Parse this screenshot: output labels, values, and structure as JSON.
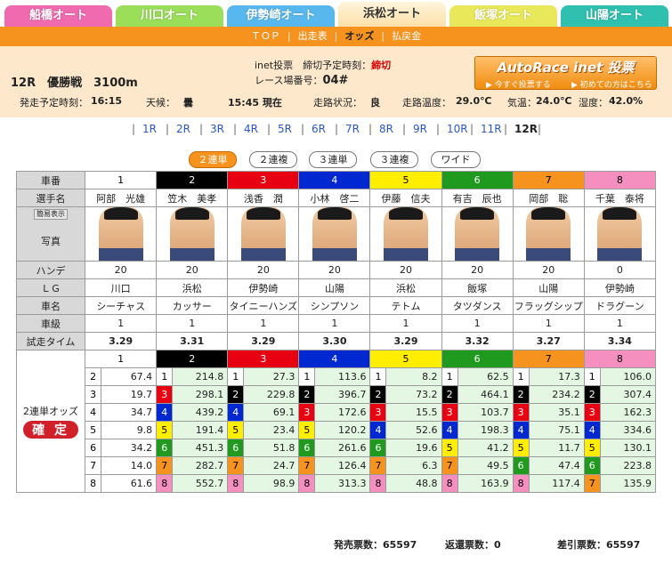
{
  "tabs": [
    {
      "label": "船橋オート",
      "color": "#f06ab0"
    },
    {
      "label": "川口オート",
      "color": "#9ade5a"
    },
    {
      "label": "伊勢崎オート",
      "color": "#58b8ee"
    },
    {
      "label": "浜松オート",
      "color": "#fde0a8",
      "active": true
    },
    {
      "label": "飯塚オート",
      "color": "#e8e85a"
    },
    {
      "label": "山陽オート",
      "color": "#30c0b0"
    }
  ],
  "subnav": [
    "ＴＯＰ",
    "出走表",
    "オッズ",
    "払戻金"
  ],
  "info": {
    "race": "12R　優勝戦　3100m",
    "inet_label": "inet投票　締切予定時刻：",
    "inet_value": "締切",
    "venue_label": "レース場番号：",
    "venue_value": "04#",
    "start_label": "発走予定時刻：",
    "start_value": "16:15",
    "weather_label": "天候：",
    "weather_value": "曇",
    "now_value": "15:45 現在",
    "track_label": "走路状況：",
    "track_value": "良",
    "track_temp_label": "走路温度：",
    "track_temp_value": "29.0℃",
    "air_label": "気温：",
    "air_value": "24.0℃",
    "humid_label": "湿度：",
    "humid_value": "42.0%"
  },
  "banner": {
    "title": "AutoRace inet 投票",
    "left": "▶ 今すぐ投票する",
    "right": "▶ 初めての方はこちら"
  },
  "race_links": [
    "1R",
    "2R",
    "3R",
    "4R",
    "5R",
    "6R",
    "7R",
    "8R",
    "9R",
    "10R",
    "11R",
    "12R"
  ],
  "bet_buttons": [
    "２連単",
    "２連複",
    "３連単",
    "３連複",
    "ワイド"
  ],
  "labels": {
    "num": "車番",
    "name": "選手名",
    "photo": "写真",
    "display": "簡易表示",
    "handicap": "ハンデ",
    "lg": "ＬＧ",
    "car": "車名",
    "rank": "車級",
    "trial": "試走タイム",
    "odds": "2連単オッズ",
    "kakutei": "確 定"
  },
  "racers": [
    {
      "num": "1",
      "name": "阿部　光雄",
      "hc": "20",
      "lg": "川口",
      "car": "シーチャス",
      "rank": "1",
      "trial": "3.29",
      "color": "#ffffff",
      "fg": "#000"
    },
    {
      "num": "2",
      "name": "笠木　美孝",
      "hc": "20",
      "lg": "浜松",
      "car": "カッサー",
      "rank": "1",
      "trial": "3.31",
      "color": "#000000",
      "fg": "#fff"
    },
    {
      "num": "3",
      "name": "浅香　潤",
      "hc": "20",
      "lg": "伊勢崎",
      "car": "タイニーハンズ",
      "rank": "1",
      "trial": "3.29",
      "color": "#e60012",
      "fg": "#fff"
    },
    {
      "num": "4",
      "name": "小林　啓二",
      "hc": "20",
      "lg": "山陽",
      "car": "シンプソン",
      "rank": "1",
      "trial": "3.30",
      "color": "#0028d0",
      "fg": "#fff"
    },
    {
      "num": "5",
      "name": "伊藤　信夫",
      "hc": "20",
      "lg": "浜松",
      "car": "テトム",
      "rank": "1",
      "trial": "3.29",
      "color": "#ffee00",
      "fg": "#000"
    },
    {
      "num": "6",
      "name": "有吉　辰也",
      "hc": "20",
      "lg": "飯塚",
      "car": "タツダンス",
      "rank": "1",
      "trial": "3.32",
      "color": "#1f9a1f",
      "fg": "#fff"
    },
    {
      "num": "7",
      "name": "岡部　聡",
      "hc": "20",
      "lg": "山陽",
      "car": "フラッグシップ",
      "rank": "1",
      "trial": "3.27",
      "color": "#f5931e",
      "fg": "#000"
    },
    {
      "num": "8",
      "name": "千葉　泰将",
      "hc": "0",
      "lg": "伊勢崎",
      "car": "ドラグーン",
      "rank": "1",
      "trial": "3.34",
      "color": "#f48fbf",
      "fg": "#000"
    }
  ],
  "odds": [
    [
      [
        "2",
        "67.4"
      ],
      [
        "1",
        "214.8"
      ],
      [
        "1",
        "27.3"
      ],
      [
        "1",
        "113.6"
      ],
      [
        "1",
        "8.2"
      ],
      [
        "1",
        "62.5"
      ],
      [
        "1",
        "17.3"
      ],
      [
        "1",
        "106.0"
      ]
    ],
    [
      [
        "3",
        "19.7"
      ],
      [
        "3",
        "298.1"
      ],
      [
        "2",
        "229.8"
      ],
      [
        "2",
        "396.7"
      ],
      [
        "2",
        "73.2"
      ],
      [
        "2",
        "464.1"
      ],
      [
        "2",
        "234.2"
      ],
      [
        "2",
        "307.4"
      ]
    ],
    [
      [
        "4",
        "34.7"
      ],
      [
        "4",
        "439.2"
      ],
      [
        "4",
        "69.1"
      ],
      [
        "3",
        "172.6"
      ],
      [
        "3",
        "15.5"
      ],
      [
        "3",
        "103.7"
      ],
      [
        "3",
        "35.1"
      ],
      [
        "3",
        "162.3"
      ]
    ],
    [
      [
        "5",
        "9.8"
      ],
      [
        "5",
        "191.4"
      ],
      [
        "5",
        "23.4"
      ],
      [
        "5",
        "120.2"
      ],
      [
        "4",
        "52.6"
      ],
      [
        "4",
        "198.3"
      ],
      [
        "4",
        "75.1"
      ],
      [
        "4",
        "334.6"
      ]
    ],
    [
      [
        "6",
        "34.2"
      ],
      [
        "6",
        "451.3"
      ],
      [
        "6",
        "51.8"
      ],
      [
        "6",
        "261.6"
      ],
      [
        "6",
        "19.6"
      ],
      [
        "5",
        "41.2"
      ],
      [
        "5",
        "11.7"
      ],
      [
        "5",
        "130.1"
      ]
    ],
    [
      [
        "7",
        "14.0"
      ],
      [
        "7",
        "282.7"
      ],
      [
        "7",
        "24.7"
      ],
      [
        "7",
        "126.4"
      ],
      [
        "7",
        "6.3"
      ],
      [
        "7",
        "49.5"
      ],
      [
        "6",
        "47.4"
      ],
      [
        "6",
        "223.8"
      ]
    ],
    [
      [
        "8",
        "61.6"
      ],
      [
        "8",
        "552.7"
      ],
      [
        "8",
        "98.9"
      ],
      [
        "8",
        "313.3"
      ],
      [
        "8",
        "48.8"
      ],
      [
        "8",
        "163.9"
      ],
      [
        "8",
        "117.4"
      ],
      [
        "7",
        "135.9"
      ]
    ]
  ],
  "highlights": [
    "0-4-8.2",
    "3-0-9.8",
    "5-4-6.3"
  ],
  "footer": {
    "sales_label": "発売票数：",
    "sales_value": "65597",
    "refund_label": "返還票数：",
    "refund_value": "0",
    "net_label": "差引票数：",
    "net_value": "65597"
  }
}
